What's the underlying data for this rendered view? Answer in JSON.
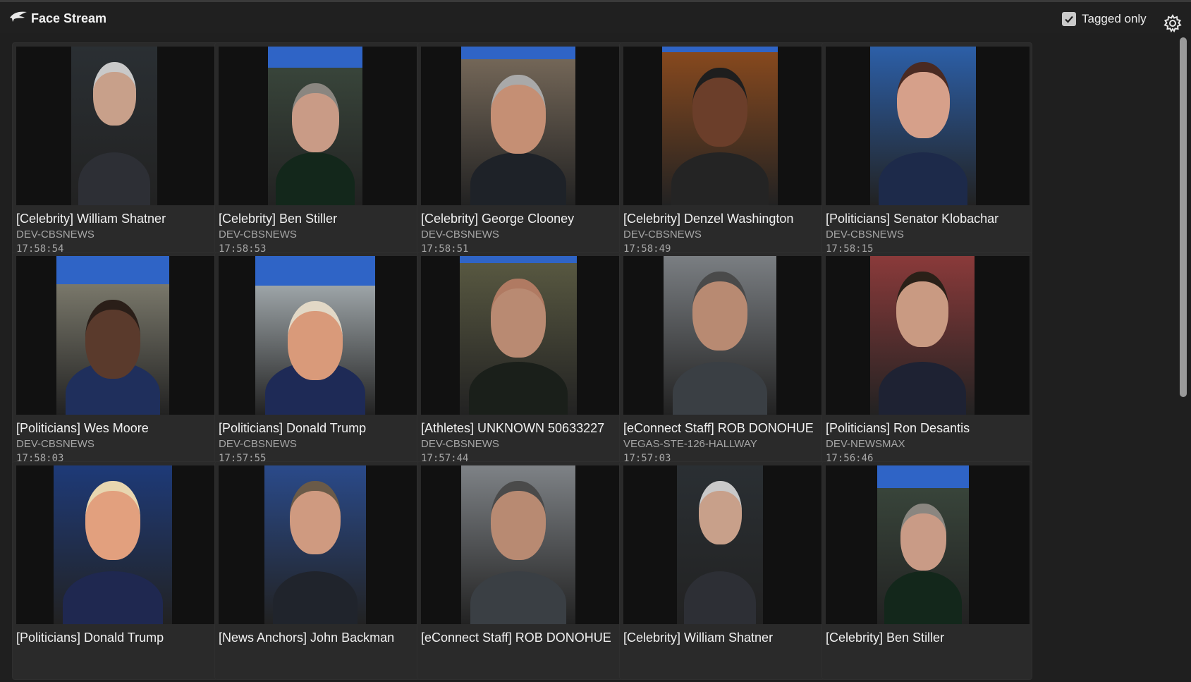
{
  "header": {
    "title": "Face Stream",
    "tagged_label": "Tagged only",
    "tagged_checked": true
  },
  "icons": {
    "logo": "bird-logo-icon",
    "checkbox": "checkmark-icon",
    "settings": "gear-icon"
  },
  "colors": {
    "accent_bar": "#2f64c6",
    "card_bg": "#2a2a2a"
  },
  "cards": [
    {
      "name": "[Celebrity] William Shatner",
      "source": "DEV-CBSNEWS",
      "time": "17:58:54"
    },
    {
      "name": "[Celebrity] Ben Stiller",
      "source": "DEV-CBSNEWS",
      "time": "17:58:53"
    },
    {
      "name": "[Celebrity] George Clooney",
      "source": "DEV-CBSNEWS",
      "time": "17:58:51"
    },
    {
      "name": "[Celebrity] Denzel Washington",
      "source": "DEV-CBSNEWS",
      "time": "17:58:49"
    },
    {
      "name": "[Politicians] Senator Klobachar",
      "source": "DEV-CBSNEWS",
      "time": "17:58:15"
    },
    {
      "name": "[Politicians] Wes Moore",
      "source": "DEV-CBSNEWS",
      "time": "17:58:03"
    },
    {
      "name": "[Politicians] Donald Trump",
      "source": "DEV-CBSNEWS",
      "time": "17:57:55"
    },
    {
      "name": "[Athletes] UNKNOWN 50633227",
      "source": "DEV-CBSNEWS",
      "time": "17:57:44"
    },
    {
      "name": "[eConnect Staff] ROB DONOHUE",
      "source": "VEGAS-STE-126-HALLWAY",
      "time": "17:57:03"
    },
    {
      "name": "[Politicians] Ron Desantis",
      "source": "DEV-NEWSMAX",
      "time": "17:56:46"
    },
    {
      "name": "[Politicians] Donald Trump",
      "source": "",
      "time": ""
    },
    {
      "name": "[News Anchors] John Backman",
      "source": "",
      "time": ""
    },
    {
      "name": "[eConnect Staff] ROB DONOHUE",
      "source": "",
      "time": ""
    },
    {
      "name": "[Celebrity] William Shatner",
      "source": "",
      "time": ""
    },
    {
      "name": "[Celebrity] Ben Stiller",
      "source": "",
      "time": ""
    }
  ]
}
